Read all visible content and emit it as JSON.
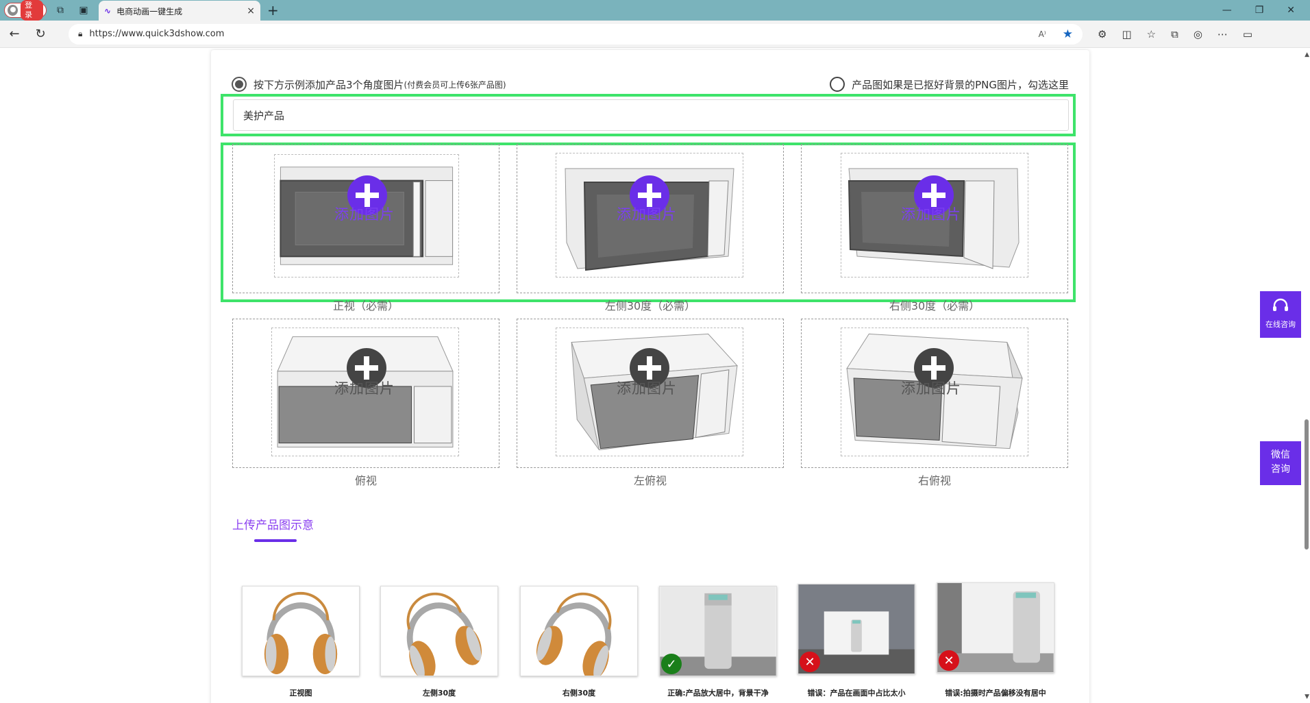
{
  "browser": {
    "profile_label": "登录",
    "tab_title": "电商动画一键生成",
    "tab_close": "×",
    "new_tab": "+",
    "url": "https://www.quick3dshow.com"
  },
  "form": {
    "option_left_main": "按下方示例添加产品3个角度图片",
    "option_left_note": "(付费会员可上传6张产品图)",
    "option_right": "产品图如果是已抠好背景的PNG图片，勾选这里",
    "name_value": "美护产品",
    "add_label": "添加图片",
    "slots": [
      {
        "caption": "正视（必需）",
        "required": true,
        "view": "front"
      },
      {
        "caption": "左侧30度（必需）",
        "required": true,
        "view": "left30"
      },
      {
        "caption": "右侧30度（必需）",
        "required": true,
        "view": "right30"
      },
      {
        "caption": "俯视",
        "required": false,
        "view": "top"
      },
      {
        "caption": "左俯视",
        "required": false,
        "view": "lefttop"
      },
      {
        "caption": "右俯视",
        "required": false,
        "view": "righttop"
      }
    ],
    "required_accent": "#6a2ee8",
    "optional_accent": "#444444",
    "highlight_color": "#3ee36a"
  },
  "examples": {
    "title": "上传产品图示意",
    "items": [
      {
        "label": "正视图",
        "kind": "headphones",
        "status": "none"
      },
      {
        "label": "左侧30度",
        "kind": "headphones",
        "status": "none"
      },
      {
        "label": "右侧30度",
        "kind": "headphones",
        "status": "none"
      },
      {
        "label": "正确:产品放大居中，背景干净",
        "kind": "purifier",
        "status": "ok"
      },
      {
        "label": "错误：产品在画面中占比太小",
        "kind": "purifier-small",
        "status": "bad"
      },
      {
        "label": "错误:拍摄时产品偏移没有居中",
        "kind": "purifier-offset",
        "status": "bad"
      }
    ]
  },
  "float": {
    "online": "在线咨询",
    "wechat_1": "微信",
    "wechat_2": "咨询"
  }
}
